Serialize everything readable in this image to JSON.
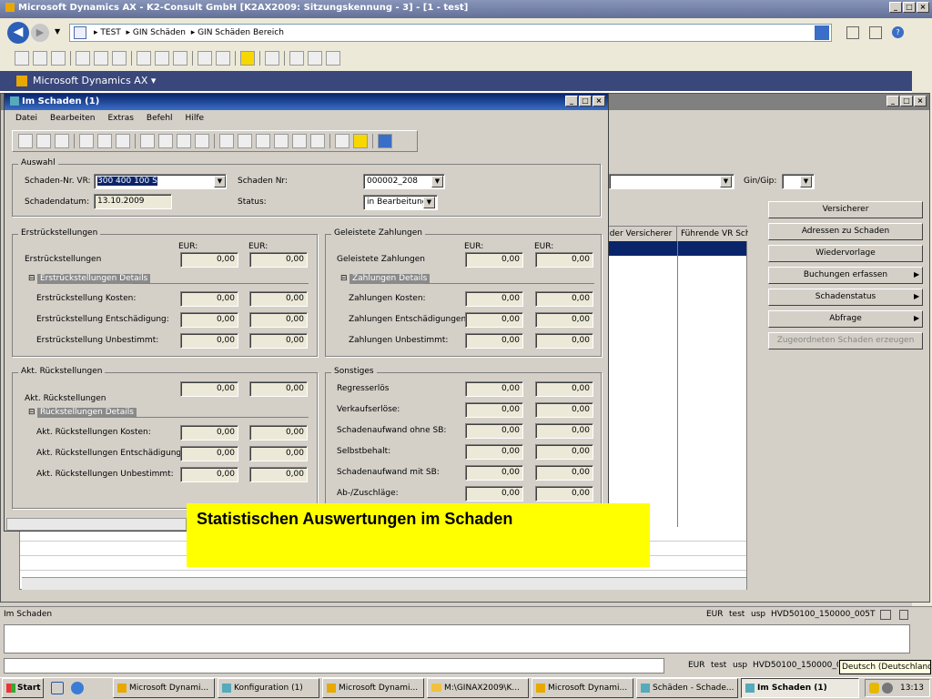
{
  "app": {
    "title": "Microsoft Dynamics AX - K2-Consult GmbH [K2AX2009: Sitzungskennung - 3] - [1 - test]"
  },
  "address": {
    "crumbs": [
      "TEST",
      "GIN Schäden",
      "GIN Schäden Bereich"
    ]
  },
  "ax_menu": {
    "label": "Microsoft Dynamics AX"
  },
  "form": {
    "title": "Im Schaden (1)",
    "menu": [
      "Datei",
      "Bearbeiten",
      "Extras",
      "Befehl",
      "Hilfe"
    ]
  },
  "auswahl": {
    "title": "Auswahl",
    "nr_label": "Schaden-Nr. VR:",
    "nr_value": "300 400 100 S",
    "datum_label": "Schadendatum:",
    "datum_value": "13.10.2009",
    "snr_label": "Schaden Nr:",
    "snr_value": "000002_208",
    "status_label": "Status:",
    "status_value": "in Bearbeitung"
  },
  "erst": {
    "title": "Erstrückstellungen",
    "eur1": "EUR:",
    "eur2": "EUR:",
    "main_label": "Erstrückstellungen",
    "details": "Erstrückstellungen Details",
    "rows": [
      {
        "label": "Erstrückstellung Kosten:",
        "v1": "0,00",
        "v2": "0,00"
      },
      {
        "label": "Erstrückstellung Entschädigung:",
        "v1": "0,00",
        "v2": "0,00"
      },
      {
        "label": "Erstrückstellung Unbestimmt:",
        "v1": "0,00",
        "v2": "0,00"
      }
    ],
    "v1": "0,00",
    "v2": "0,00"
  },
  "zahl": {
    "title": "Geleistete Zahlungen",
    "eur1": "EUR:",
    "eur2": "EUR:",
    "main_label": "Geleistete Zahlungen",
    "details": "Zahlungen Details",
    "rows": [
      {
        "label": "Zahlungen Kosten:",
        "v1": "0,00",
        "v2": "0,00"
      },
      {
        "label": "Zahlungen Entschädigungen:",
        "v1": "0,00",
        "v2": "0,00"
      },
      {
        "label": "Zahlungen Unbestimmt:",
        "v1": "0,00",
        "v2": "0,00"
      }
    ],
    "v1": "0,00",
    "v2": "0,00"
  },
  "akt": {
    "title": "Akt. Rückstellungen",
    "main_label": "Akt. Rückstellungen",
    "details": "Rückstellungen Details",
    "rows": [
      {
        "label": "Akt. Rückstellungen Kosten:",
        "v1": "0,00",
        "v2": "0,00"
      },
      {
        "label": "Akt. Rückstellungen Entschädigung:",
        "v1": "0,00",
        "v2": "0,00"
      },
      {
        "label": "Akt. Rückstellungen Unbestimmt:",
        "v1": "0,00",
        "v2": "0,00"
      }
    ],
    "v1": "0,00",
    "v2": "0,00"
  },
  "sonst": {
    "title": "Sonstiges",
    "rows": [
      {
        "label": "Regresserlös",
        "v1": "0,00",
        "v2": "0,00"
      },
      {
        "label": "Verkaufserlöse:",
        "v1": "0,00",
        "v2": "0,00"
      },
      {
        "label": "Schadenaufwand ohne SB:",
        "v1": "0,00",
        "v2": "0,00"
      },
      {
        "label": "Selbstbehalt:",
        "v1": "0,00",
        "v2": "0,00"
      },
      {
        "label": "Schadenaufwand mit SB:",
        "v1": "0,00",
        "v2": "0,00"
      },
      {
        "label": "Ab-/Zuschläge:",
        "v1": "0,00",
        "v2": "0,00"
      }
    ]
  },
  "background": {
    "gin_label": "Gin/Gip:",
    "col1": "nder Versicherer",
    "col2": "Führende VR Sch",
    "buttons": [
      "Versicherer",
      "Adressen zu Schaden",
      "Wiedervorlage",
      "Buchungen erfassen",
      "Schadenstatus",
      "Abfrage",
      "Zugeordneten Schaden erzeugen"
    ]
  },
  "callout": {
    "text": "Statistischen Auswertungen im Schaden"
  },
  "status": {
    "left": "Im Schaden",
    "cells": [
      "EUR",
      "test",
      "usp",
      "HVD50100_150000_005T"
    ]
  },
  "status2": {
    "cells": [
      "EUR",
      "test",
      "usp",
      "HVD50100_150000_0"
    ],
    "tooltip": "Deutsch (Deutschland)"
  },
  "taskbar": {
    "start": "Start",
    "tasks": [
      "Microsoft Dynami...",
      "Konfiguration (1)",
      "Microsoft Dynami...",
      "M:\\GINAX2009\\K...",
      "Microsoft Dynami...",
      "Schäden - Schade...",
      "Im Schaden (1)"
    ],
    "clock": "13:13"
  },
  "colors": {
    "titlebar": "#5a6b97",
    "callout": "#ffff00",
    "selection": "#0a246a"
  }
}
